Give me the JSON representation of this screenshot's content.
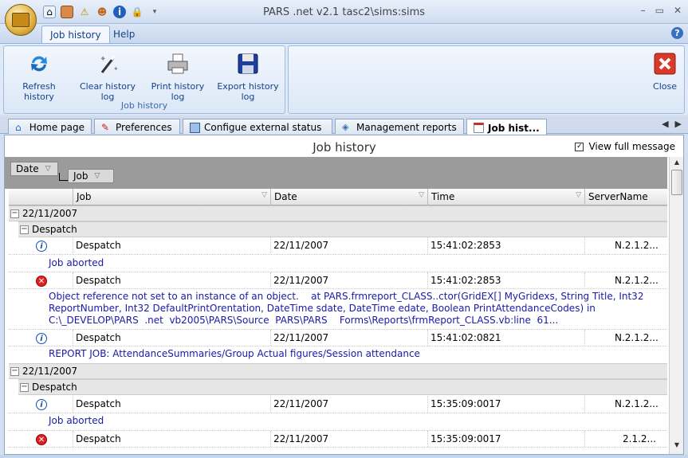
{
  "window": {
    "title": "PARS .net v2.1  tasc2\\sims:sims"
  },
  "quick_access": [
    "home-icon",
    "archive-icon",
    "warning-icon",
    "user-icon",
    "info-icon",
    "lock-icon",
    "dropdown-icon"
  ],
  "ribbon_tabs": [
    {
      "label": "Job history"
    },
    {
      "label": "Help"
    }
  ],
  "ribbon": {
    "group_label": "Job history",
    "buttons": [
      {
        "label": "Refresh history",
        "icon": "refresh-icon"
      },
      {
        "label": "Clear history log",
        "icon": "magic-wand-icon"
      },
      {
        "label": "Print history log",
        "icon": "printer-icon"
      },
      {
        "label": "Export history log",
        "icon": "save-icon"
      }
    ],
    "close_label": "Close"
  },
  "doc_tabs": [
    {
      "label": "Home page",
      "icon": "home-icon"
    },
    {
      "label": "Preferences",
      "icon": "brush-icon"
    },
    {
      "label": "Configue external status",
      "icon": "monitor-icon"
    },
    {
      "label": "Management reports",
      "icon": "report-icon"
    },
    {
      "label": "Job hist...",
      "icon": "calendar-icon"
    }
  ],
  "content": {
    "title": "Job history",
    "view_full_message": "View full message",
    "group_chips": [
      "Date",
      "Job"
    ],
    "columns": [
      "Job",
      "Date",
      "Time",
      "ServerName"
    ]
  },
  "rows": {
    "g1_date": "22/11/2007",
    "g1_job": "Despatch",
    "r1": {
      "job": "Despatch",
      "date": "22/11/2007",
      "time": "15:41:02:2853",
      "server": "N.2.1.2...",
      "message": "Job aborted"
    },
    "r2": {
      "job": "Despatch",
      "date": "22/11/2007",
      "time": "15:41:02:2853",
      "server": "N.2.1.2...",
      "message": "Object reference not set to an instance of an object.    at PARS.frmreport_CLASS..ctor(GridEX[] MyGridexs, String Title, Int32\nReportNumber, Int32 DefaultPrintOrentation, DateTime sdate, DateTime edate, Boolean PrintAttendanceCodes) in\nC:\\_DEVELOP\\PARS  .net  vb2005\\PARS\\Source  PARS\\PARS    Forms\\Reports\\frmReport_CLASS.vb:line  61..."
    },
    "r3": {
      "job": "Despatch",
      "date": "22/11/2007",
      "time": "15:41:02:0821",
      "server": "N.2.1.2...",
      "message": "REPORT JOB: AttendanceSummaries/Group Actual figures/Session attendance"
    },
    "g2_date": "22/11/2007",
    "g2_job": "Despatch",
    "r4": {
      "job": "Despatch",
      "date": "22/11/2007",
      "time": "15:35:09:0017",
      "server": "N.2.1.2...",
      "message": "Job aborted"
    },
    "r5": {
      "job": "Despatch",
      "date": "22/11/2007",
      "time": "15:35:09:0017",
      "server": "2.1.2..."
    }
  }
}
